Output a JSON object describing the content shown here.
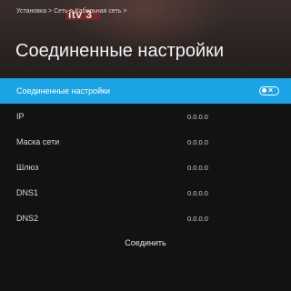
{
  "breadcrumb": "Установка > Сеть > Кабельная сеть >",
  "title": "Соединенные настройки",
  "background_logo_text": "itv 3",
  "selected_row": {
    "label": "Соединенные настройки",
    "toggle_state": "off",
    "toggle_symbol": "×"
  },
  "rows": [
    {
      "label": "IP",
      "value": "0.0.0.0"
    },
    {
      "label": "Маска сети",
      "value": "0.0.0.0"
    },
    {
      "label": "Шлюз",
      "value": "0.0.0.0"
    },
    {
      "label": "DNS1",
      "value": "0.0.0.0"
    },
    {
      "label": "DNS2",
      "value": "0.0.0.0"
    }
  ],
  "connect_label": "Соединить",
  "colors": {
    "accent": "#1aa4e6",
    "background": "#121212",
    "text": "#e6e6e6"
  }
}
